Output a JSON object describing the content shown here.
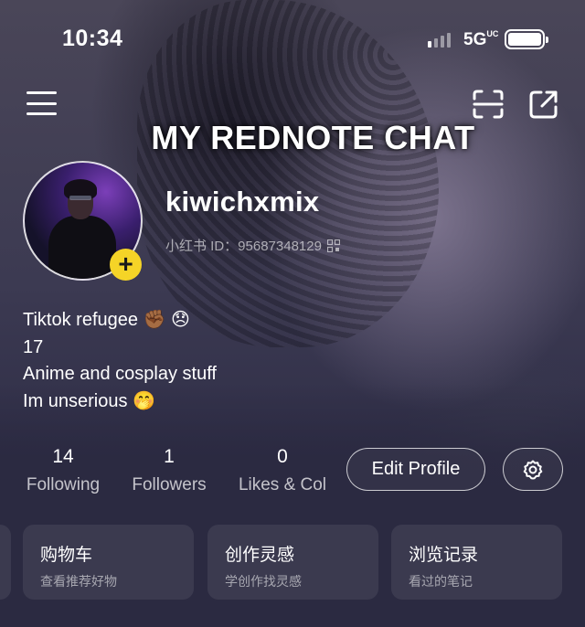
{
  "status_bar": {
    "time": "10:34",
    "network": "5G",
    "network_suffix": "UC",
    "battery_level": 1.0
  },
  "header": {
    "banner_title": "MY REDNOTE CHAT",
    "icons": [
      "menu-icon",
      "scan-icon",
      "share-icon"
    ]
  },
  "profile": {
    "username": "kiwichxmix",
    "id_label": "小红书 ID：95687348129",
    "bio": [
      "Tiktok refugee ✊🏾 😞",
      "17",
      "Anime and cosplay stuff",
      "Im unserious 🤭"
    ]
  },
  "stats": {
    "following": {
      "count": "14",
      "label": "Following"
    },
    "followers": {
      "count": "1",
      "label": "Followers"
    },
    "likes": {
      "count": "0",
      "label": "Likes & Col"
    }
  },
  "actions": {
    "edit_profile": "Edit Profile",
    "settings_icon": "gear-icon"
  },
  "cards": [
    {
      "title": "购物车",
      "subtitle": "查看推荐好物"
    },
    {
      "title": "创作灵感",
      "subtitle": "学创作找灵感"
    },
    {
      "title": "浏览记录",
      "subtitle": "看过的笔记"
    }
  ],
  "colors": {
    "background": "#2b2a40",
    "add_badge": "#f5d427"
  }
}
